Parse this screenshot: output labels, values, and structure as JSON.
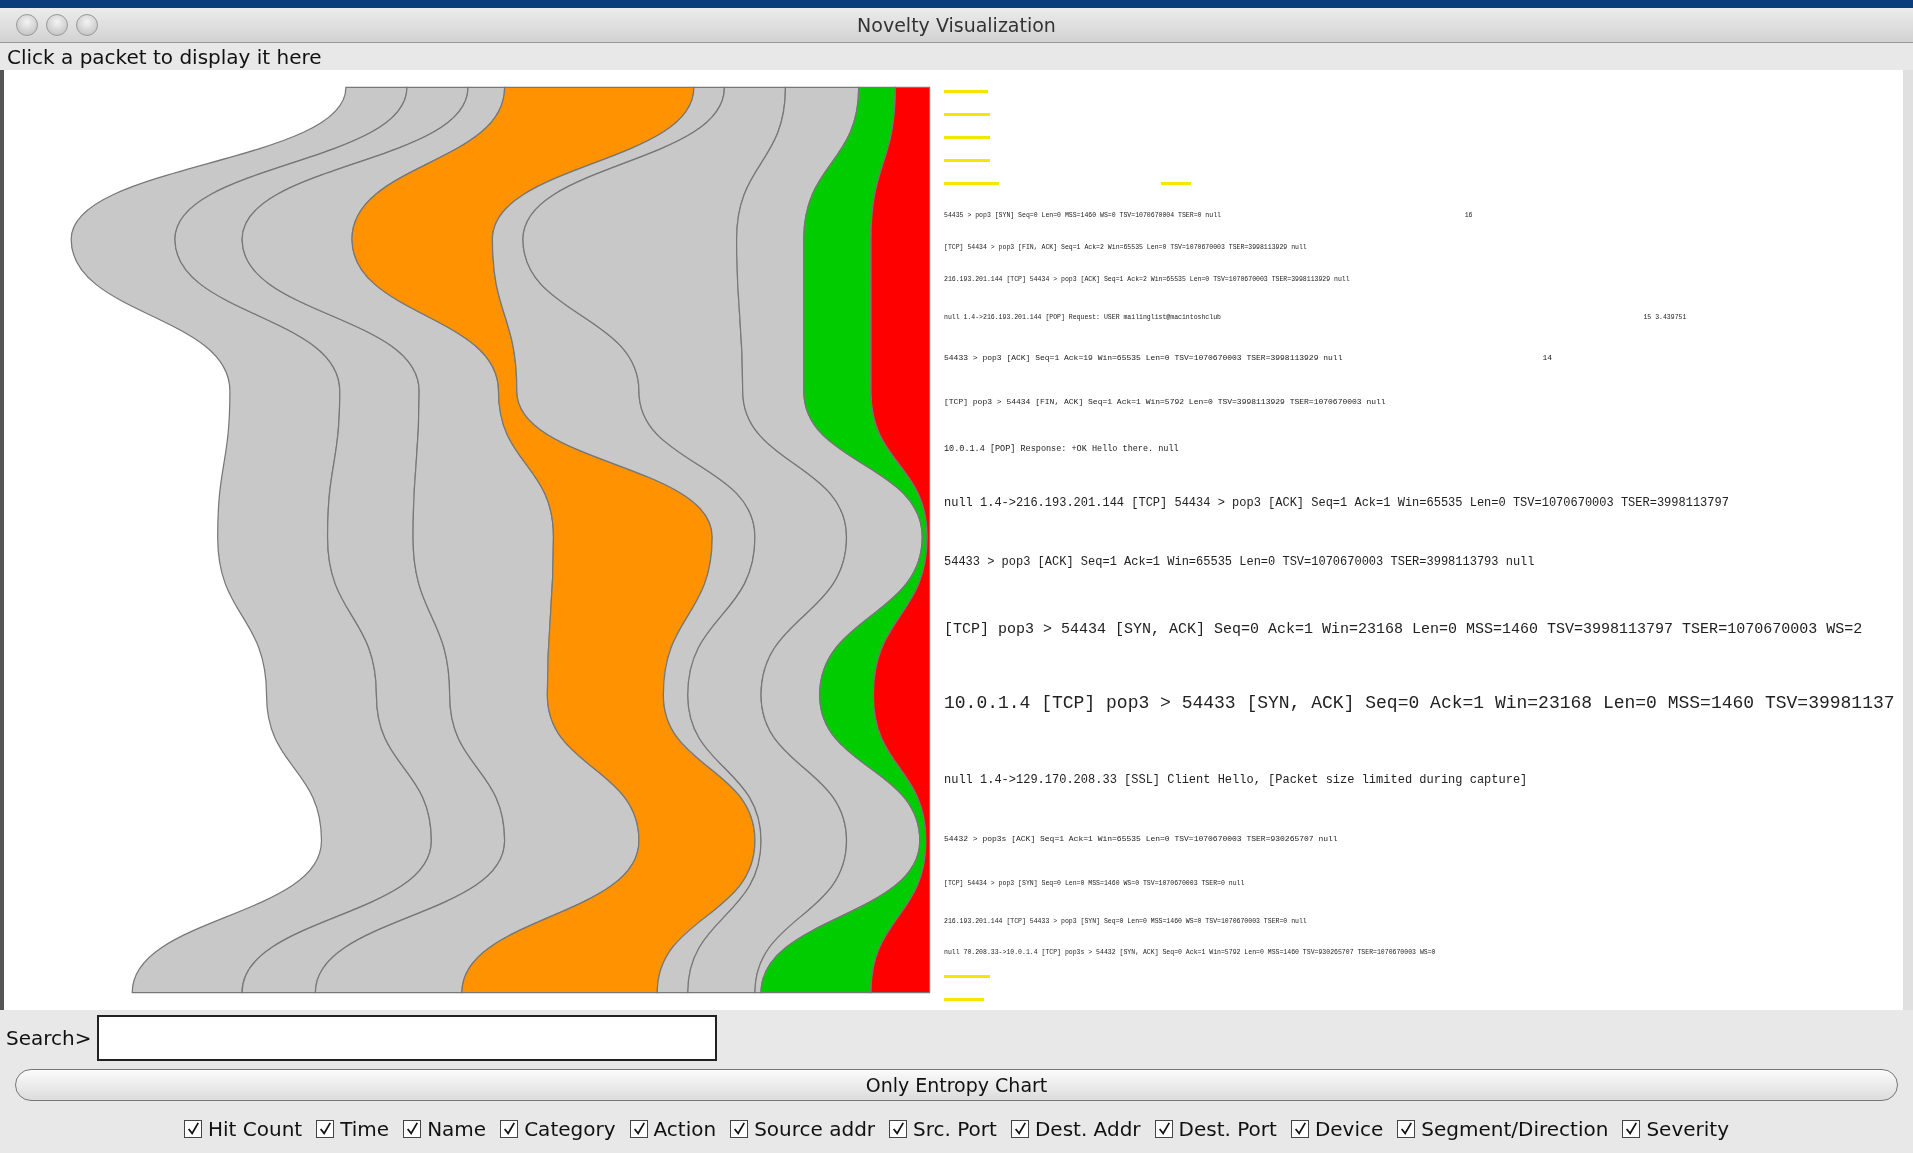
{
  "window": {
    "title": "Novelty Visualization"
  },
  "detail_label": "Click a packet to display it here",
  "packets": [
    {
      "text": "54435 > pop3 [SYN] Seq=0 Len=0 MSS=1460 WS=0 TSV=1070670004 TSER=0 null",
      "extra": "16"
    },
    {
      "text": "[TCP] 54434 > pop3 [FIN, ACK] Seq=1 Ack=2 Win=65535 Len=0 TSV=1070670003 TSER=3998113929 null"
    },
    {
      "text": "216.193.201.144 [TCP] 54434 > pop3 [ACK] Seq=1 Ack=2 Win=65535 Len=0 TSV=1070670003 TSER=3998113929 null"
    },
    {
      "text": "null 1.4->216.193.201.144 [POP] Request: USER mailinglist@macintoshclub",
      "extra": "15 3.439751"
    },
    {
      "text": "54433 > pop3 [ACK] Seq=1 Ack=19 Win=65535 Len=0 TSV=1070670003 TSER=3998113929 null",
      "extra": "14"
    },
    {
      "text": "[TCP] pop3 > 54434 [FIN, ACK] Seq=1 Ack=1 Win=5792 Len=0 TSV=3998113929 TSER=1070670003 null"
    },
    {
      "text": "10.0.1.4 [POP] Response: +OK Hello there. null"
    },
    {
      "text": "null 1.4->216.193.201.144 [TCP] 54434 > pop3 [ACK] Seq=1 Ack=1 Win=65535 Len=0 TSV=1070670003 TSER=3998113797"
    },
    {
      "text": "54433 > pop3 [ACK] Seq=1 Ack=1 Win=65535 Len=0 TSV=1070670003 TSER=3998113793 null"
    },
    {
      "text": "[TCP] pop3 > 54434 [SYN, ACK] Seq=0 Ack=1 Win=23168 Len=0 MSS=1460 TSV=3998113797 TSER=1070670003 WS=2"
    },
    {
      "text": "10.0.1.4 [TCP] pop3 > 54433 [SYN, ACK] Seq=0 Ack=1 Win=23168 Len=0 MSS=1460 TSV=39981137"
    },
    {
      "text": "null 1.4->129.170.208.33 [SSL] Client Hello, [Packet size limited during capture]"
    },
    {
      "text": "54432 > pop3s [ACK] Seq=1 Ack=1 Win=65535 Len=0 TSV=1070670003 TSER=930265707 null"
    },
    {
      "text": "[TCP] 54434 > pop3 [SYN] Seq=0 Len=0 MSS=1460 WS=0 TSV=1070670003 TSER=0 null"
    },
    {
      "text": "216.193.201.144 [TCP] 54433 > pop3 [SYN] Seq=0 Len=0 MSS=1460 WS=0 TSV=1070670003 TSER=0 null"
    },
    {
      "text": "null 70.208.33->10.0.1.4 [TCP] pop3s > 54432 [SYN, ACK] Seq=0 Ack=1 Win=5792 Len=0 MSS=1460 TSV=930265707 TSER=1070670003 WS=0"
    }
  ],
  "search": {
    "label": "Search>"
  },
  "chart_button": "Only Entropy Chart",
  "columns": [
    {
      "label": "Hit Count",
      "checked": true
    },
    {
      "label": "Time",
      "checked": true
    },
    {
      "label": "Name",
      "checked": true
    },
    {
      "label": "Category",
      "checked": true
    },
    {
      "label": "Action",
      "checked": true
    },
    {
      "label": "Source addr",
      "checked": true
    },
    {
      "label": "Src. Port",
      "checked": true
    },
    {
      "label": "Dest. Addr",
      "checked": true
    },
    {
      "label": "Dest. Port",
      "checked": true
    },
    {
      "label": "Device",
      "checked": true
    },
    {
      "label": "Segment/Direction",
      "checked": true
    },
    {
      "label": "Severity",
      "checked": true
    }
  ]
}
